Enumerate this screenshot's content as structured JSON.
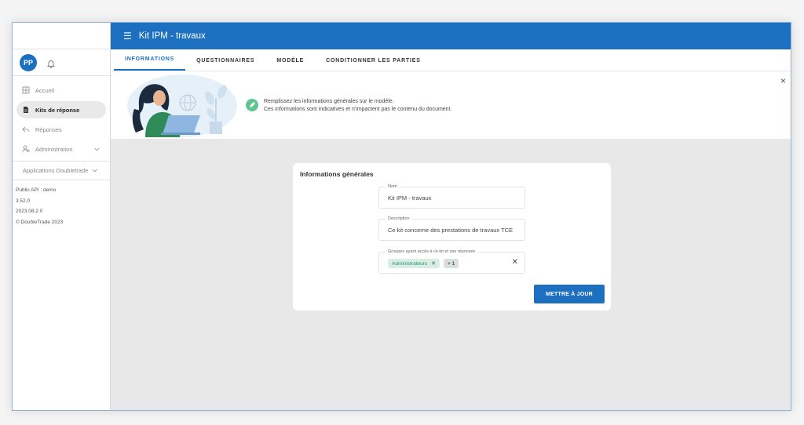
{
  "app": {
    "title": "Kit IPM - travaux",
    "menu_icon": "menu-icon"
  },
  "user": {
    "initials": "PP",
    "bell_icon": "bell-icon"
  },
  "sidebar": {
    "items": [
      {
        "label": "Accueil",
        "icon": "home-icon"
      },
      {
        "label": "Kits de réponse",
        "icon": "document-icon"
      },
      {
        "label": "Réponses",
        "icon": "reply-icon"
      },
      {
        "label": "Administration",
        "icon": "admin-icon"
      }
    ],
    "apps_label": "Applications Doubletrade",
    "meta": [
      "Public API : demo",
      "3.52.0",
      "2023.08.2.0",
      "© DoubleTrade 2023"
    ]
  },
  "tabs": [
    "INFORMATIONS",
    "QUESTIONNAIRES",
    "MODÈLE",
    "CONDITIONNER LES PARTIES"
  ],
  "banner": {
    "line1": "Remplissez les informations générales sur le modèle.",
    "line2": "Ces informations sont indicatives et n'impactent pas le contenu du document.",
    "close": "×"
  },
  "form": {
    "title": "Informations générales",
    "name_label": "Nom",
    "name_value": "Kit IPM - travaux",
    "desc_label": "Description",
    "desc_value": "Ce kit concerne des prestations de travaux TCE",
    "groups_label": "Groupes ayant accès à ce kit et ses réponses",
    "groups": [
      "Administrateurs"
    ],
    "groups_more": "+ 1",
    "chip_remove": "✕",
    "clear": "✕",
    "submit_label": "METTRE À JOUR"
  },
  "colors": {
    "primary": "#1d6fc0",
    "accent_green": "#5ec592",
    "chip_bg": "#d7eee5"
  }
}
